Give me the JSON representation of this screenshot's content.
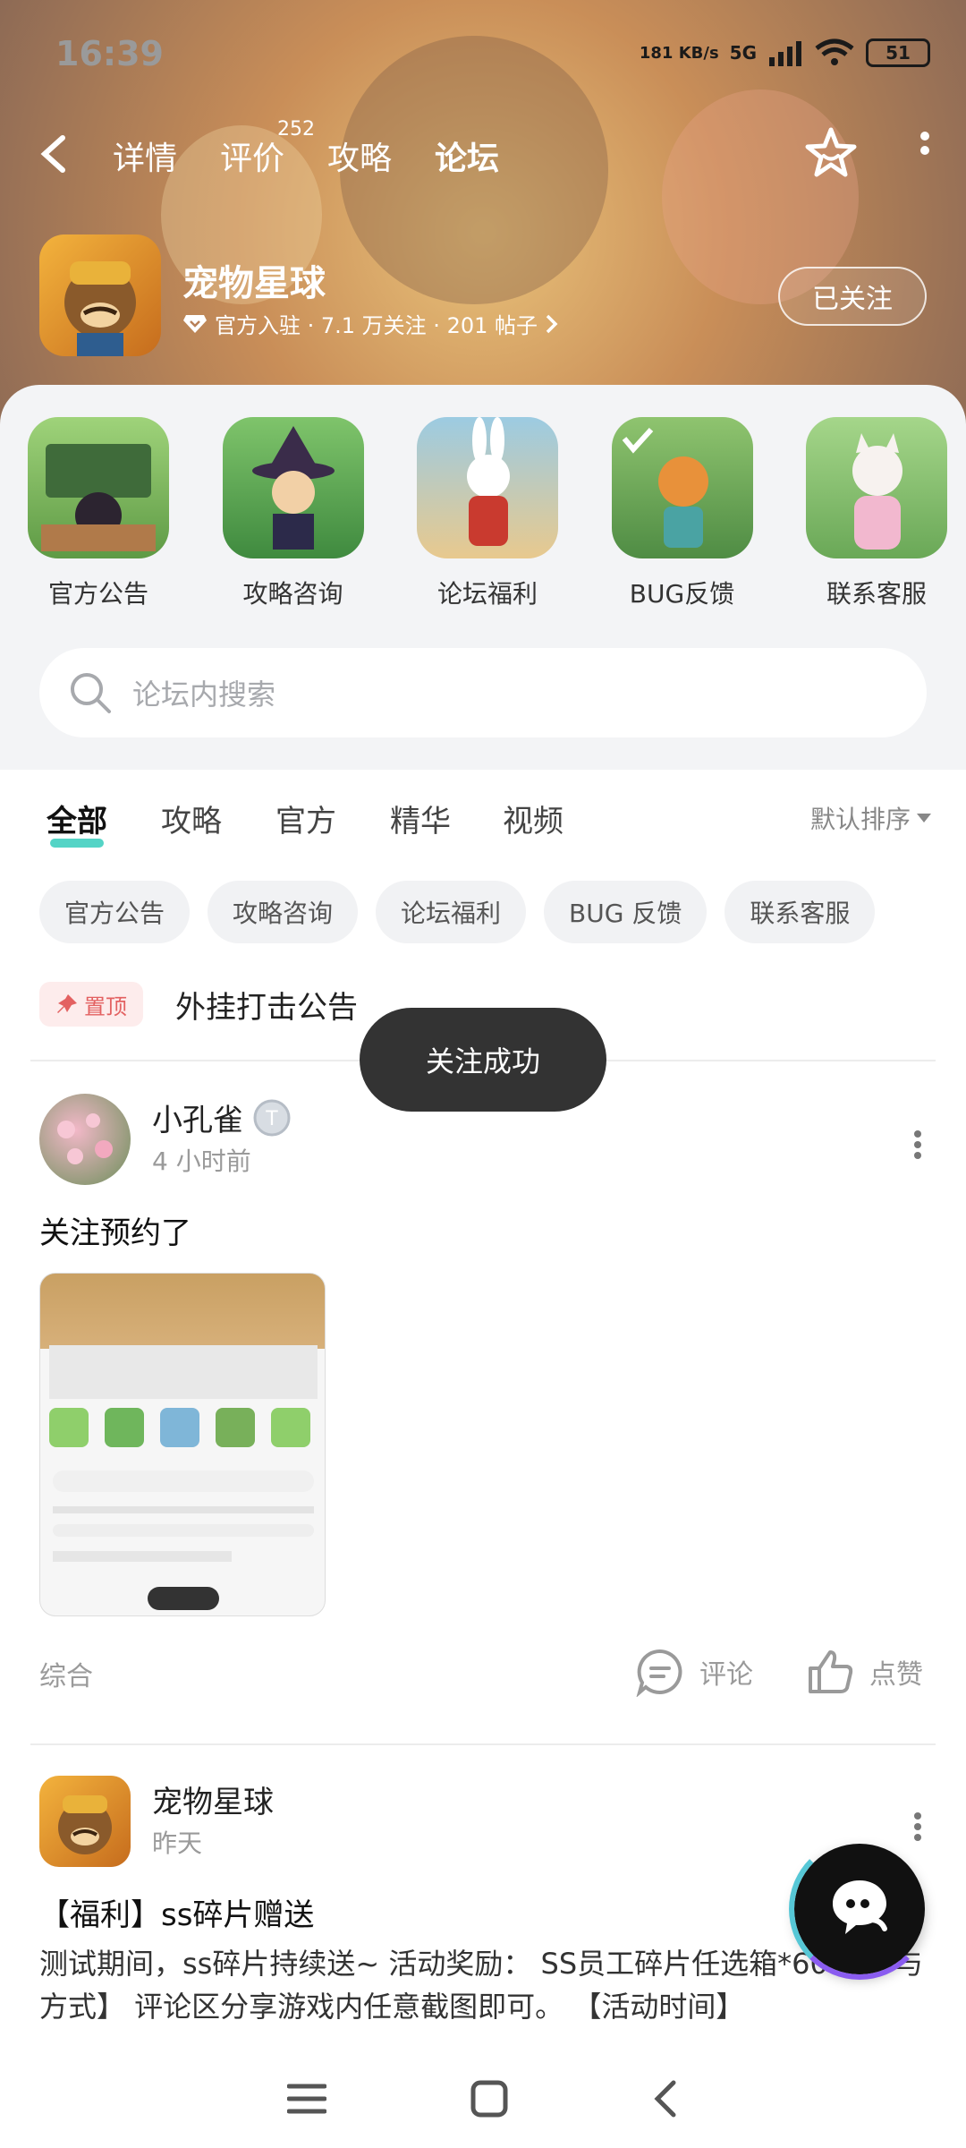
{
  "status_bar": {
    "time": "16:39",
    "net_speed": "181 KB/s",
    "network": "5G",
    "battery": "51"
  },
  "nav": {
    "tabs": [
      "详情",
      "评价",
      "攻略",
      "论坛"
    ],
    "active_tab": "论坛",
    "review_count": "252"
  },
  "app": {
    "name": "宠物星球",
    "meta": "官方入驻 · 7.1 万关注 · 201 帖子",
    "follow_label": "已关注"
  },
  "categories": [
    {
      "label": "官方公告",
      "color": "#8fcf6b"
    },
    {
      "label": "攻略咨询",
      "color": "#6fb65c"
    },
    {
      "label": "论坛福利",
      "color": "#7fb6d8"
    },
    {
      "label": "BUG反馈",
      "color": "#78b05a"
    },
    {
      "label": "联系客服",
      "color": "#8fcf6b"
    }
  ],
  "search": {
    "placeholder": "论坛内搜索"
  },
  "filter_tabs": [
    "全部",
    "攻略",
    "官方",
    "精华",
    "视频"
  ],
  "sort_label": "默认排序",
  "chips": [
    "官方公告",
    "攻略咨询",
    "论坛福利",
    "BUG 反馈",
    "联系客服"
  ],
  "pinned": {
    "badge": "置顶",
    "title": "外挂打击公告"
  },
  "toast": "关注成功",
  "post1": {
    "author": "小孔雀",
    "time": "4 小时前",
    "text": "关注预约了",
    "tag": "综合",
    "comment_label": "评论",
    "like_label": "点赞"
  },
  "post2": {
    "author": "宠物星球",
    "time": "昨天",
    "title": "【福利】ss碎片赠送",
    "body": "测试期间，ss碎片持续送~ 活动奖励： SS员工碎片任选箱*60 【参与方式】 评论区分享游戏内任意截图即可。 【活动时间】"
  },
  "colors": {
    "accent": "#54d4c6",
    "pin_red": "#e36161"
  }
}
